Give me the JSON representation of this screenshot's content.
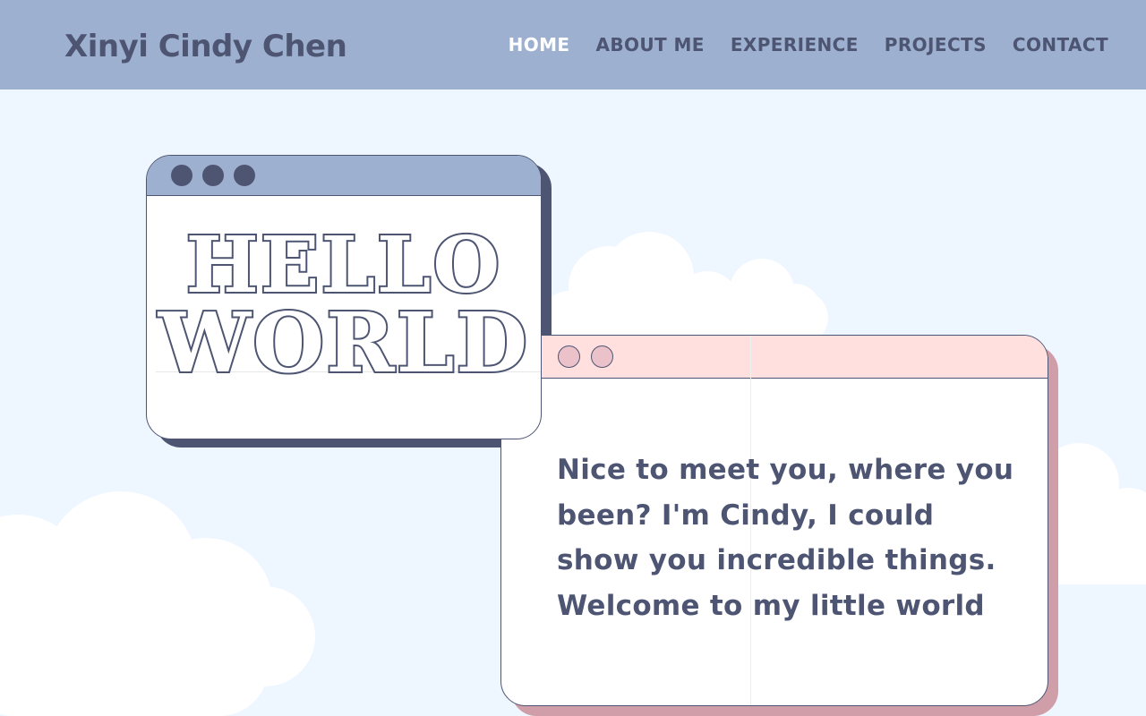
{
  "header": {
    "brand": "Xinyi Cindy Chen",
    "nav": [
      {
        "label": "HOME",
        "active": true
      },
      {
        "label": "ABOUT ME",
        "active": false
      },
      {
        "label": "EXPERIENCE",
        "active": false
      },
      {
        "label": "PROJECTS",
        "active": false
      },
      {
        "label": "CONTACT",
        "active": false
      }
    ]
  },
  "hero": {
    "hello_line1": "HELLO",
    "hello_line2": "WORLD",
    "intro_text": "Nice to meet you, where you been? I'm Cindy, I could show you incredible things. Welcome to my little world"
  },
  "colors": {
    "nav_bg": "#9db0cf",
    "page_bg": "#eef6ff",
    "ink": "#4d5572",
    "active_nav": "#ffffff",
    "pink_bar": "#ffe0df",
    "pink_shadow": "#d09ea8"
  }
}
